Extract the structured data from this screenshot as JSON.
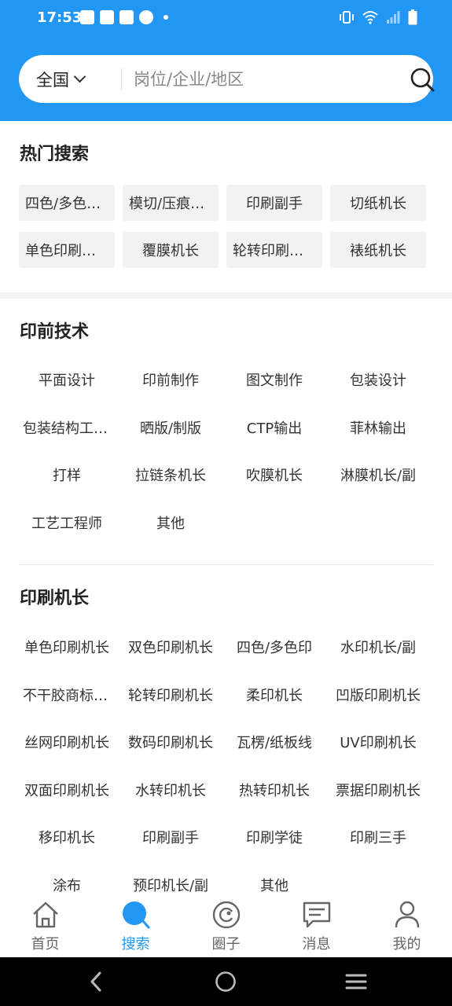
{
  "status": {
    "time": "17:53"
  },
  "search": {
    "region": "全国",
    "placeholder": "岗位/企业/地区"
  },
  "hot": {
    "title": "热门搜索",
    "items": [
      "四色/多色印刷机长",
      "模切/压痕机长",
      "印刷副手",
      "切纸机长",
      "单色印刷机长",
      "覆膜机长",
      "轮转印刷机长",
      "裱纸机长"
    ]
  },
  "prepress": {
    "title": "印前技术",
    "items": [
      "平面设计",
      "印前制作",
      "图文制作",
      "包装设计",
      "包装结构工程师",
      "晒版/制版",
      "CTP输出",
      "菲林输出",
      "打样",
      "拉链条机长",
      "吹膜机长",
      "淋膜机长/副",
      "工艺工程师",
      "其他"
    ]
  },
  "press": {
    "title": "印刷机长",
    "items": [
      "单色印刷机长",
      "双色印刷机长",
      "四色/多色印",
      "水印机长/副",
      "不干胶商标印刷机长",
      "轮转印刷机长",
      "柔印机长",
      "凹版印刷机长",
      "丝网印刷机长",
      "数码印刷机长",
      "瓦楞/纸板线",
      "UV印刷机长",
      "双面印刷机长",
      "水转印机长",
      "热转印机长",
      "票据印刷机长",
      "移印机长",
      "印刷副手",
      "印刷学徒",
      "印刷三手",
      "涂布",
      "预印机长/副",
      "其他"
    ]
  },
  "tabs": [
    {
      "id": "home",
      "label": "首页",
      "icon": "home-icon"
    },
    {
      "id": "search",
      "label": "搜索",
      "icon": "search-icon",
      "active": true
    },
    {
      "id": "circle",
      "label": "圈子",
      "icon": "circle-icon"
    },
    {
      "id": "messages",
      "label": "消息",
      "icon": "chat-icon"
    },
    {
      "id": "mine",
      "label": "我的",
      "icon": "user-icon"
    }
  ],
  "colors": {
    "accent": "#2196f3"
  }
}
